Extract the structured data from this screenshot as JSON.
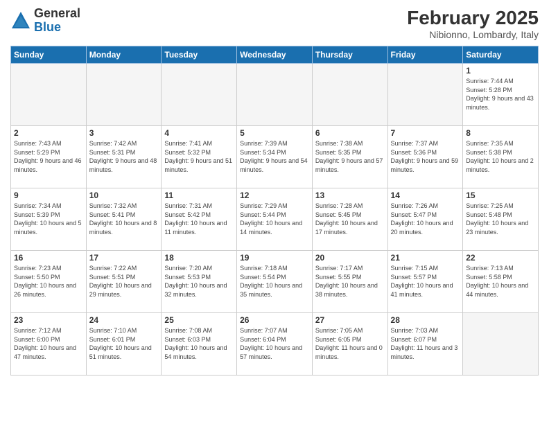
{
  "header": {
    "logo": {
      "general": "General",
      "blue": "Blue"
    },
    "title": "February 2025",
    "location": "Nibionno, Lombardy, Italy"
  },
  "calendar": {
    "weekdays": [
      "Sunday",
      "Monday",
      "Tuesday",
      "Wednesday",
      "Thursday",
      "Friday",
      "Saturday"
    ],
    "weeks": [
      [
        {
          "day": "",
          "info": "",
          "empty": true
        },
        {
          "day": "",
          "info": "",
          "empty": true
        },
        {
          "day": "",
          "info": "",
          "empty": true
        },
        {
          "day": "",
          "info": "",
          "empty": true
        },
        {
          "day": "",
          "info": "",
          "empty": true
        },
        {
          "day": "",
          "info": "",
          "empty": true
        },
        {
          "day": "1",
          "info": "Sunrise: 7:44 AM\nSunset: 5:28 PM\nDaylight: 9 hours and 43 minutes."
        }
      ],
      [
        {
          "day": "2",
          "info": "Sunrise: 7:43 AM\nSunset: 5:29 PM\nDaylight: 9 hours and 46 minutes."
        },
        {
          "day": "3",
          "info": "Sunrise: 7:42 AM\nSunset: 5:31 PM\nDaylight: 9 hours and 48 minutes."
        },
        {
          "day": "4",
          "info": "Sunrise: 7:41 AM\nSunset: 5:32 PM\nDaylight: 9 hours and 51 minutes."
        },
        {
          "day": "5",
          "info": "Sunrise: 7:39 AM\nSunset: 5:34 PM\nDaylight: 9 hours and 54 minutes."
        },
        {
          "day": "6",
          "info": "Sunrise: 7:38 AM\nSunset: 5:35 PM\nDaylight: 9 hours and 57 minutes."
        },
        {
          "day": "7",
          "info": "Sunrise: 7:37 AM\nSunset: 5:36 PM\nDaylight: 9 hours and 59 minutes."
        },
        {
          "day": "8",
          "info": "Sunrise: 7:35 AM\nSunset: 5:38 PM\nDaylight: 10 hours and 2 minutes."
        }
      ],
      [
        {
          "day": "9",
          "info": "Sunrise: 7:34 AM\nSunset: 5:39 PM\nDaylight: 10 hours and 5 minutes."
        },
        {
          "day": "10",
          "info": "Sunrise: 7:32 AM\nSunset: 5:41 PM\nDaylight: 10 hours and 8 minutes."
        },
        {
          "day": "11",
          "info": "Sunrise: 7:31 AM\nSunset: 5:42 PM\nDaylight: 10 hours and 11 minutes."
        },
        {
          "day": "12",
          "info": "Sunrise: 7:29 AM\nSunset: 5:44 PM\nDaylight: 10 hours and 14 minutes."
        },
        {
          "day": "13",
          "info": "Sunrise: 7:28 AM\nSunset: 5:45 PM\nDaylight: 10 hours and 17 minutes."
        },
        {
          "day": "14",
          "info": "Sunrise: 7:26 AM\nSunset: 5:47 PM\nDaylight: 10 hours and 20 minutes."
        },
        {
          "day": "15",
          "info": "Sunrise: 7:25 AM\nSunset: 5:48 PM\nDaylight: 10 hours and 23 minutes."
        }
      ],
      [
        {
          "day": "16",
          "info": "Sunrise: 7:23 AM\nSunset: 5:50 PM\nDaylight: 10 hours and 26 minutes."
        },
        {
          "day": "17",
          "info": "Sunrise: 7:22 AM\nSunset: 5:51 PM\nDaylight: 10 hours and 29 minutes."
        },
        {
          "day": "18",
          "info": "Sunrise: 7:20 AM\nSunset: 5:53 PM\nDaylight: 10 hours and 32 minutes."
        },
        {
          "day": "19",
          "info": "Sunrise: 7:18 AM\nSunset: 5:54 PM\nDaylight: 10 hours and 35 minutes."
        },
        {
          "day": "20",
          "info": "Sunrise: 7:17 AM\nSunset: 5:55 PM\nDaylight: 10 hours and 38 minutes."
        },
        {
          "day": "21",
          "info": "Sunrise: 7:15 AM\nSunset: 5:57 PM\nDaylight: 10 hours and 41 minutes."
        },
        {
          "day": "22",
          "info": "Sunrise: 7:13 AM\nSunset: 5:58 PM\nDaylight: 10 hours and 44 minutes."
        }
      ],
      [
        {
          "day": "23",
          "info": "Sunrise: 7:12 AM\nSunset: 6:00 PM\nDaylight: 10 hours and 47 minutes."
        },
        {
          "day": "24",
          "info": "Sunrise: 7:10 AM\nSunset: 6:01 PM\nDaylight: 10 hours and 51 minutes."
        },
        {
          "day": "25",
          "info": "Sunrise: 7:08 AM\nSunset: 6:03 PM\nDaylight: 10 hours and 54 minutes."
        },
        {
          "day": "26",
          "info": "Sunrise: 7:07 AM\nSunset: 6:04 PM\nDaylight: 10 hours and 57 minutes."
        },
        {
          "day": "27",
          "info": "Sunrise: 7:05 AM\nSunset: 6:05 PM\nDaylight: 11 hours and 0 minutes."
        },
        {
          "day": "28",
          "info": "Sunrise: 7:03 AM\nSunset: 6:07 PM\nDaylight: 11 hours and 3 minutes."
        },
        {
          "day": "",
          "info": "",
          "empty": true
        }
      ]
    ]
  }
}
